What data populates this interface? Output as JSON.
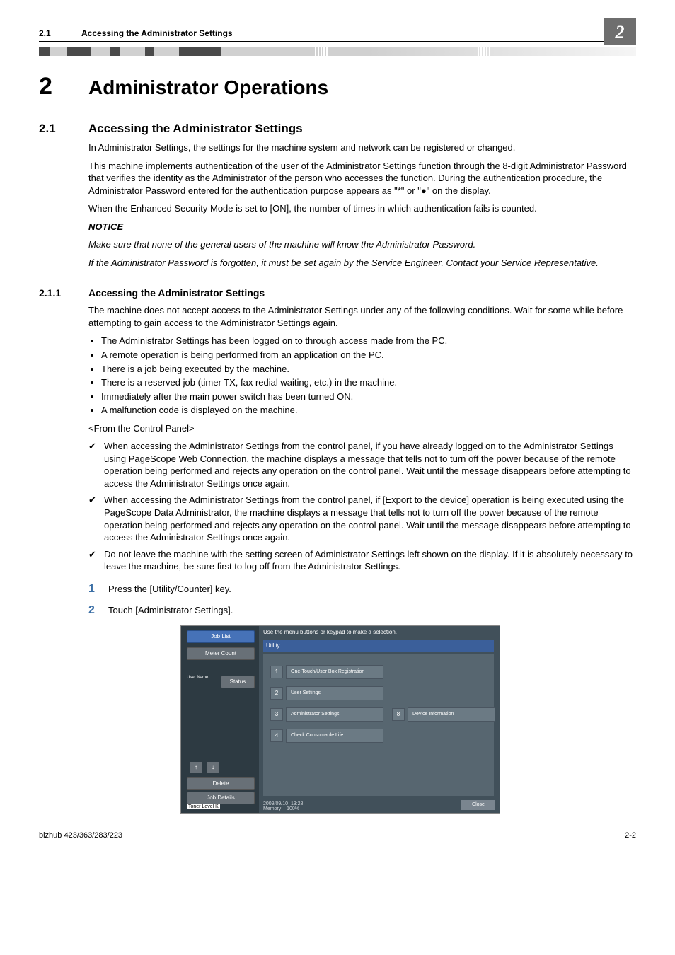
{
  "header": {
    "section_number": "2.1",
    "section_title": "Accessing the Administrator Settings",
    "chapter_badge": "2"
  },
  "chapter": {
    "number": "2",
    "title": "Administrator Operations"
  },
  "section21": {
    "number": "2.1",
    "title": "Accessing the Administrator Settings",
    "p1": "In Administrator Settings, the settings for the machine system and network can be registered or changed.",
    "p2": "This machine implements authentication of the user of the Administrator Settings function through the 8-digit Administrator Password that verifies the identity as the Administrator of the person who accesses the function. During the authentication procedure, the Administrator Password entered for the authentication purpose appears as \"*\" or \"●\" on the display.",
    "p3": "When the Enhanced Security Mode is set to [ON], the number of times in which authentication fails is counted.",
    "notice_label": "NOTICE",
    "notice1": "Make sure that none of the general users of the machine will know the Administrator Password.",
    "notice2": "If the Administrator Password is forgotten, it must be set again by the Service Engineer. Contact your Service Representative."
  },
  "section211": {
    "number": "2.1.1",
    "title": "Accessing the Administrator Settings",
    "intro": "The machine does not accept access to the Administrator Settings under any of the following conditions. Wait for some while before attempting to gain access to the Administrator Settings again.",
    "bullets": [
      "The Administrator Settings has been logged on to through access made from the PC.",
      "A remote operation is being performed from an application on the PC.",
      "There is a job being executed by the machine.",
      "There is a reserved job (timer TX, fax redial waiting, etc.) in the machine.",
      "Immediately after the main power switch has been turned ON.",
      "A malfunction code is displayed on the machine."
    ],
    "from_cp": "<From the Control Panel>",
    "checks": [
      "When accessing the Administrator Settings from the control panel, if you have already logged on to the Administrator Settings using PageScope Web Connection, the machine displays a message that tells not to turn off the power because of the remote operation being performed and rejects any operation on the control panel. Wait until the message disappears before attempting to access the Administrator Settings once again.",
      "When accessing the Administrator Settings from the control panel, if [Export to the device] operation is being executed using the PageScope Data Administrator, the machine displays a message that tells not to turn off the power because of the remote operation being performed and rejects any operation on the control panel. Wait until the message disappears before attempting to access the Administrator Settings once again.",
      "Do not leave the machine with the setting screen of Administrator Settings left shown on the display. If it is absolutely necessary to leave the machine, be sure first to log off from the Administrator Settings."
    ],
    "step1_num": "1",
    "step1": "Press the [Utility/Counter] key.",
    "step2_num": "2",
    "step2": "Touch [Administrator Settings]."
  },
  "screenshot": {
    "job_list": "Job List",
    "meter_count": "Meter Count",
    "user_name": "User Name",
    "status": "Status",
    "delete": "Delete",
    "job_details": "Job Details",
    "toner": "Toner Level  K",
    "top_msg": "Use the menu buttons or keypad to make a selection.",
    "utility": "Utility",
    "row1_num": "1",
    "row1": "One-Touch/User Box Registration",
    "row2_num": "2",
    "row2": "User Settings",
    "row3_num": "3",
    "row3": "Administrator Settings",
    "row3b_num": "8",
    "row3b": "Device Information",
    "row4_num": "4",
    "row4": "Check Consumable Life",
    "close": "Close",
    "date": "2009/09/10",
    "time": "13:28",
    "memory": "Memory",
    "memval": "100%"
  },
  "footer": {
    "left": "bizhub 423/363/283/223",
    "right": "2-2"
  }
}
